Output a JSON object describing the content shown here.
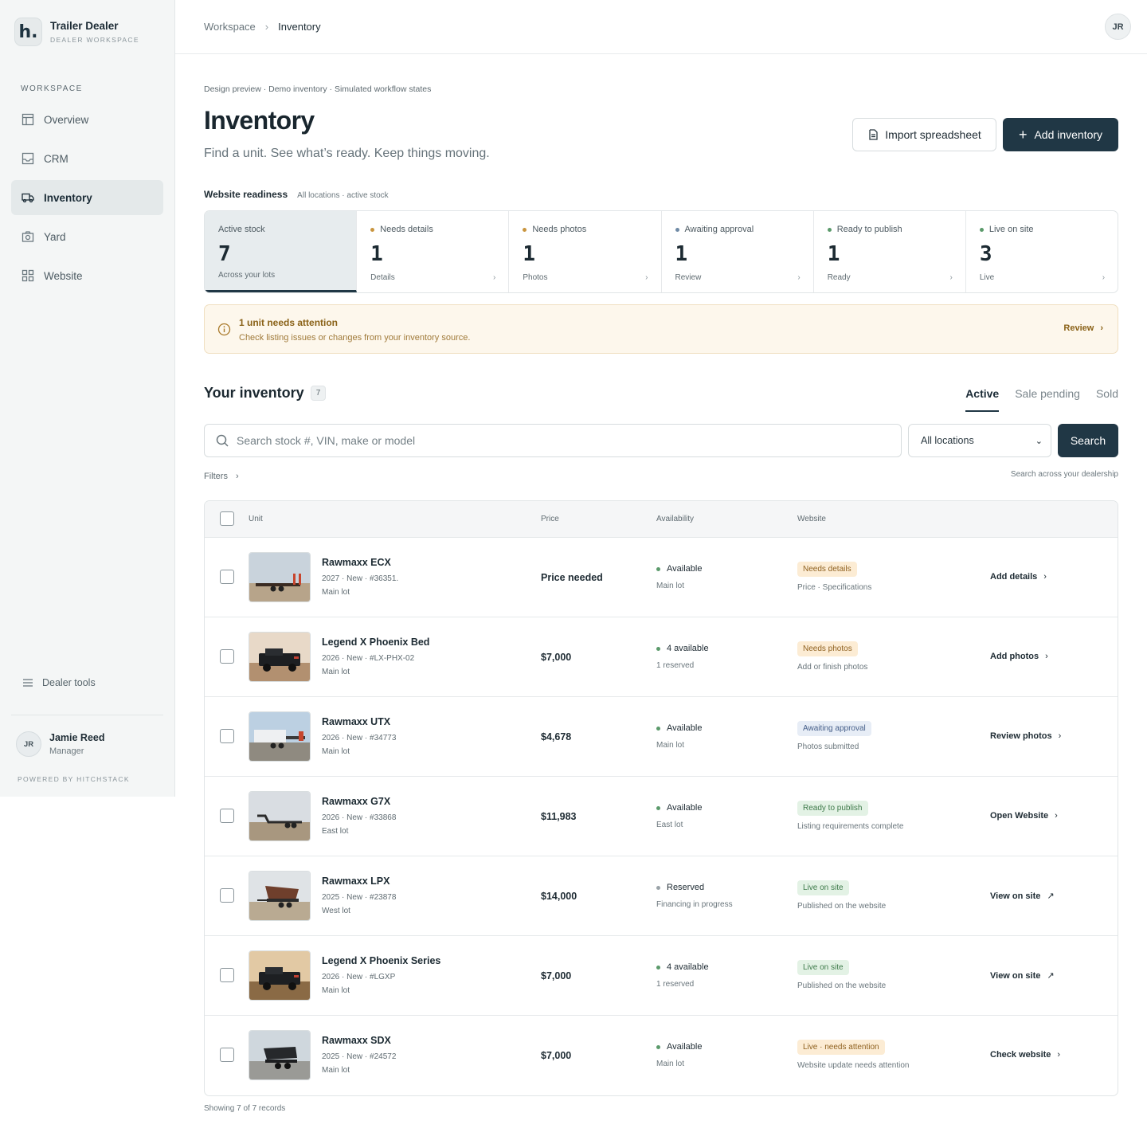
{
  "brand": {
    "logo": "h.",
    "name": "Trailer Dealer",
    "subtitle": "DEALER WORKSPACE"
  },
  "sidebar": {
    "section_label": "WORKSPACE",
    "items": [
      {
        "label": "Overview",
        "icon": "layout-icon",
        "active": false
      },
      {
        "label": "CRM",
        "icon": "inbox-icon",
        "active": false
      },
      {
        "label": "Inventory",
        "icon": "truck-icon",
        "active": true
      },
      {
        "label": "Yard",
        "icon": "camera-icon",
        "active": false
      },
      {
        "label": "Website",
        "icon": "grid-icon",
        "active": false
      }
    ],
    "dealer_tools": "Dealer tools",
    "user": {
      "initials": "JR",
      "name": "Jamie Reed",
      "role": "Manager"
    },
    "powered_by": "POWERED BY HITCHSTACK"
  },
  "topbar": {
    "breadcrumb": [
      "Workspace",
      "Inventory"
    ],
    "avatar_initials": "JR"
  },
  "header": {
    "preview_note": "Design preview · Demo inventory · Simulated workflow states",
    "title": "Inventory",
    "subtitle": "Find a unit. See what’s ready. Keep things moving.",
    "import_label": "Import spreadsheet",
    "add_label": "Add inventory"
  },
  "readiness": {
    "label": "Website readiness",
    "sub": "All locations · active stock",
    "stats": [
      {
        "label": "Active stock",
        "value": "7",
        "foot": "Across your lots",
        "dot": null,
        "selected": true
      },
      {
        "label": "Needs details",
        "value": "1",
        "foot": "Details",
        "dot": "#c9953f",
        "selected": false
      },
      {
        "label": "Needs photos",
        "value": "1",
        "foot": "Photos",
        "dot": "#c9953f",
        "selected": false
      },
      {
        "label": "Awaiting approval",
        "value": "1",
        "foot": "Review",
        "dot": "#6f8aa6",
        "selected": false
      },
      {
        "label": "Ready to publish",
        "value": "1",
        "foot": "Ready",
        "dot": "#5b9a6b",
        "selected": false
      },
      {
        "label": "Live on site",
        "value": "3",
        "foot": "Live",
        "dot": "#5b9a6b",
        "selected": false
      }
    ]
  },
  "alert": {
    "title": "1 unit needs attention",
    "desc": "Check listing issues or changes from your inventory source.",
    "action": "Review"
  },
  "inventory": {
    "title": "Your inventory",
    "count": "7",
    "tabs": [
      {
        "label": "Active",
        "active": true
      },
      {
        "label": "Sale pending",
        "active": false
      },
      {
        "label": "Sold",
        "active": false
      }
    ],
    "search_placeholder": "Search stock #, VIN, make or model",
    "location": "All locations",
    "search_button": "Search",
    "filters": "Filters",
    "search_hint": "Search across your dealership",
    "columns": {
      "unit": "Unit",
      "price": "Price",
      "availability": "Availability",
      "website": "Website"
    },
    "rows": [
      {
        "name": "Rawmaxx ECX",
        "meta": "2027 · New · #36351.",
        "lot": "Main lot",
        "price": "Price needed",
        "avail": "Available",
        "avail_dot": "#5b9a6b",
        "avail_sub": "Main lot",
        "badge": "Needs details",
        "badge_tone": "amber",
        "web_sub": "Price · Specifications",
        "action": "Add details",
        "action_icon": "chevron-right-icon",
        "photo": "flatbed"
      },
      {
        "name": "Legend X Phoenix Bed",
        "meta": "2026 · New · #LX-PHX-02",
        "lot": "Main lot",
        "price": "$7,000",
        "avail": "4 available",
        "avail_dot": "#5b9a6b",
        "avail_sub": "1 reserved",
        "badge": "Needs photos",
        "badge_tone": "amber",
        "web_sub": "Add or finish photos",
        "action": "Add photos",
        "action_icon": "chevron-right-icon",
        "photo": "truck"
      },
      {
        "name": "Rawmaxx UTX",
        "meta": "2026 · New · #34773",
        "lot": "Main lot",
        "price": "$4,678",
        "avail": "Available",
        "avail_dot": "#5b9a6b",
        "avail_sub": "Main lot",
        "badge": "Awaiting approval",
        "badge_tone": "blue",
        "web_sub": "Photos submitted",
        "action": "Review photos",
        "action_icon": "chevron-right-icon",
        "photo": "utility"
      },
      {
        "name": "Rawmaxx G7X",
        "meta": "2026 · New · #33868",
        "lot": "East lot",
        "price": "$11,983",
        "avail": "Available",
        "avail_dot": "#5b9a6b",
        "avail_sub": "East lot",
        "badge": "Ready to publish",
        "badge_tone": "green",
        "web_sub": "Listing requirements complete",
        "action": "Open Website",
        "action_icon": "chevron-right-icon",
        "photo": "gooseneck"
      },
      {
        "name": "Rawmaxx LPX",
        "meta": "2025 · New · #23878",
        "lot": "West lot",
        "price": "$14,000",
        "avail": "Reserved",
        "avail_dot": "#9aa3a8",
        "avail_sub": "Financing in progress",
        "badge": "Live on site",
        "badge_tone": "green",
        "web_sub": "Published on the website",
        "action": "View on site",
        "action_icon": "external-link-icon",
        "photo": "dump"
      },
      {
        "name": "Legend X Phoenix Series",
        "meta": "2026 · New · #LGXP",
        "lot": "Main lot",
        "price": "$7,000",
        "avail": "4 available",
        "avail_dot": "#5b9a6b",
        "avail_sub": "1 reserved",
        "badge": "Live on site",
        "badge_tone": "green",
        "web_sub": "Published on the website",
        "action": "View on site",
        "action_icon": "external-link-icon",
        "photo": "truck2"
      },
      {
        "name": "Rawmaxx SDX",
        "meta": "2025 · New · #24572",
        "lot": "Main lot",
        "price": "$7,000",
        "avail": "Available",
        "avail_dot": "#5b9a6b",
        "avail_sub": "Main lot",
        "badge": "Live · needs attention",
        "badge_tone": "amber",
        "web_sub": "Website update needs attention",
        "action": "Check website",
        "action_icon": "chevron-right-icon",
        "photo": "dump2"
      }
    ],
    "footer": "Showing 7 of 7 records"
  }
}
